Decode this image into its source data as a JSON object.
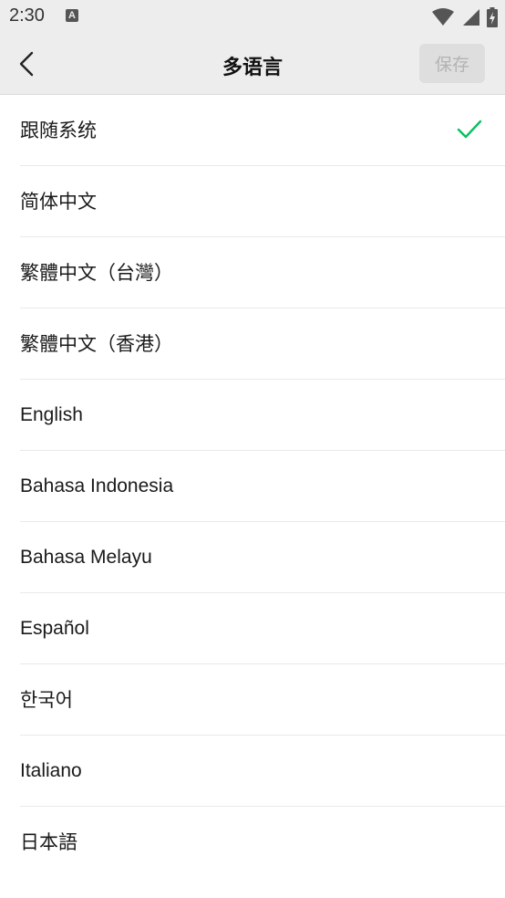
{
  "status_bar": {
    "time": "2:30",
    "notification_icon": "A"
  },
  "header": {
    "title": "多语言",
    "back_icon": "chevron-left-icon",
    "save_label": "保存"
  },
  "languages": {
    "selected_index": 0,
    "items": [
      {
        "label": "跟随系统"
      },
      {
        "label": "简体中文"
      },
      {
        "label": "繁體中文（台灣）"
      },
      {
        "label": "繁體中文（香港）"
      },
      {
        "label": "English"
      },
      {
        "label": "Bahasa Indonesia"
      },
      {
        "label": "Bahasa Melayu"
      },
      {
        "label": "Español"
      },
      {
        "label": "한국어"
      },
      {
        "label": "Italiano"
      },
      {
        "label": "日本語"
      }
    ]
  },
  "colors": {
    "check": "#07c160",
    "header_bg": "#ededed",
    "save_disabled_bg": "#dedede",
    "save_disabled_text": "#b3b3b3"
  }
}
